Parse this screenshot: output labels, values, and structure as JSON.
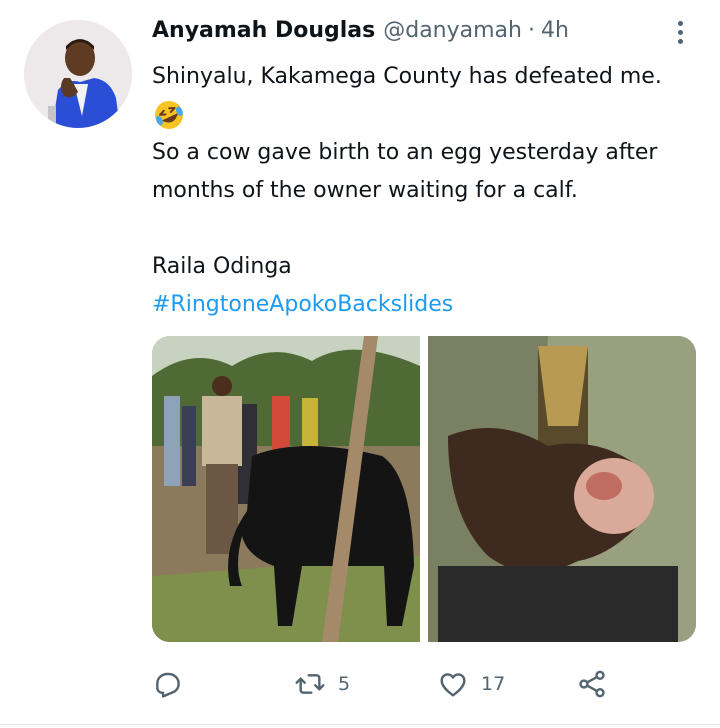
{
  "author": {
    "name": "Anyamah Douglas",
    "handle": "@danyamah",
    "separator": "·",
    "time": "4h"
  },
  "tweet": {
    "line1": "Shinyalu, Kakamega County has defeated me.",
    "emoji": "rolling-on-floor-laughing-emoji",
    "line2": "So a cow gave birth to an egg yesterday after",
    "line3": "months of the owner waiting for a calf.",
    "line4": "Raila Odinga",
    "hashtag": "#RingtoneApokoBackslides"
  },
  "media": {
    "photos": [
      {
        "content": "men-standing-around-black-cow-photo"
      },
      {
        "content": "hand-holding-egg-photo"
      }
    ]
  },
  "actions": {
    "reply_icon": "reply-icon",
    "retweet_icon": "retweet-icon",
    "retweet_count": "5",
    "like_icon": "heart-icon",
    "like_count": "17",
    "share_icon": "share-icon"
  },
  "colors": {
    "text": "#0f1419",
    "secondary": "#536471",
    "link": "#1d9bf0"
  }
}
